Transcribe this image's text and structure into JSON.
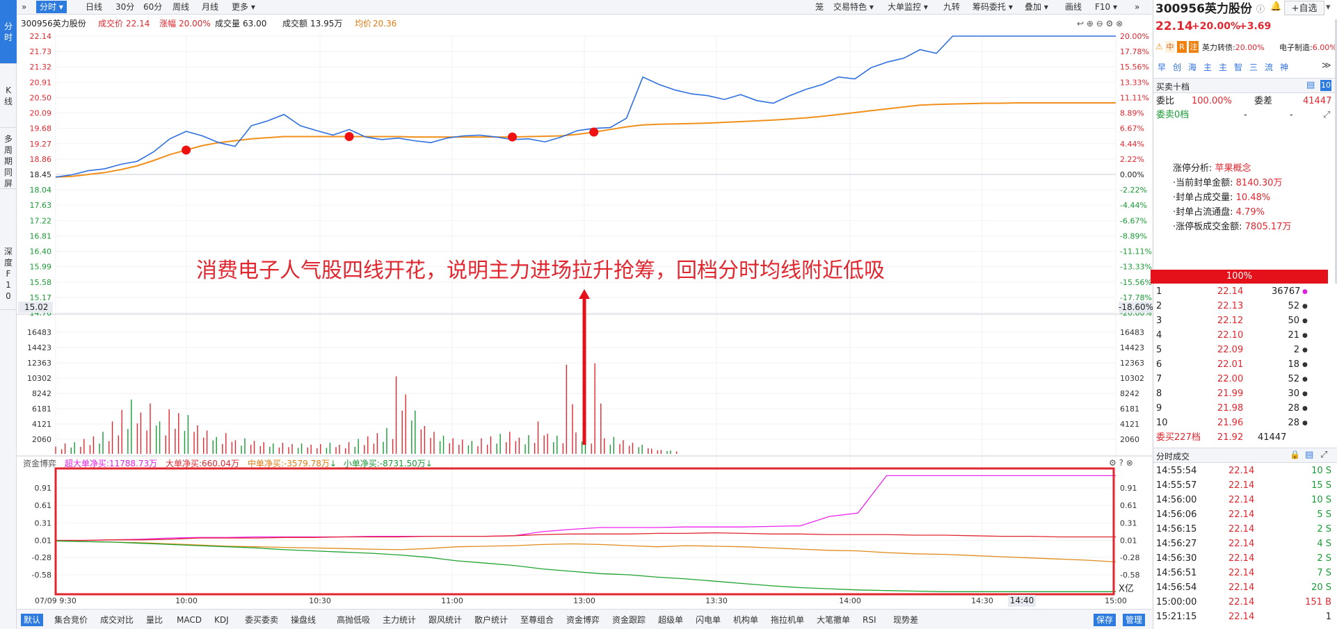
{
  "left_tabs": [
    {
      "label": "分时"
    },
    {
      "label": "K线"
    },
    {
      "label": "多周期同屏"
    },
    {
      "label": "深度F10"
    }
  ],
  "toolbar": {
    "expand_icon": "double-chevron-right-icon",
    "tabs": [
      "分时",
      "日线",
      "30分",
      "60分",
      "周线",
      "月线",
      "更多"
    ],
    "right_items": [
      "笼",
      "交易特色",
      "大单监控",
      "九转",
      "筹码委托",
      "叠加",
      "画线",
      "F10"
    ]
  },
  "stock": {
    "code_name": "300956英力股份",
    "price_label": "成交价",
    "price": "22.14",
    "change_label": "涨幅",
    "change": "20.00%",
    "volume_label": "成交量",
    "volume": "63.00",
    "amount_label": "成交额",
    "amount": "13.95万",
    "avg_label": "均价",
    "avg": "20.36"
  },
  "price_axis": {
    "left": [
      "22.14",
      "21.73",
      "21.32",
      "20.91",
      "20.50",
      "20.09",
      "19.68",
      "19.27",
      "18.86",
      "18.45",
      "18.04",
      "17.63",
      "17.22",
      "16.81",
      "16.40",
      "15.99",
      "15.58",
      "15.17",
      "14.76"
    ],
    "right": [
      "20.00%",
      "17.78%",
      "15.56%",
      "13.33%",
      "11.11%",
      "8.89%",
      "6.67%",
      "4.44%",
      "2.22%",
      "0.00%",
      "-2.22%",
      "-4.44%",
      "-6.67%",
      "-8.89%",
      "-11.11%",
      "-13.33%",
      "-15.56%",
      "-17.78%",
      "-20.00%"
    ],
    "cursor_left": "15.02",
    "cursor_right": "-18.60%"
  },
  "volume_axis": [
    "16483",
    "14423",
    "12363",
    "10302",
    "8242",
    "6181",
    "4121",
    "2060"
  ],
  "fund_panel": {
    "title": "资金博弈",
    "super_large": "超大单净买:11788.73万",
    "large": "大单净买:660.04万",
    "medium": "中单净买:-3579.78万",
    "small": "小单净买:-8731.50万",
    "axis": [
      "0.91",
      "0.61",
      "0.31",
      "0.01",
      "-0.28",
      "-0.58"
    ],
    "unit": "X亿"
  },
  "time_axis": [
    "07/09 9:30",
    "10:00",
    "10:30",
    "11:00",
    "13:00",
    "13:30",
    "14:00",
    "14:30",
    "15:00"
  ],
  "time_cursor": "14:40",
  "annotation": "消费电子人气股四线开花，说明主力进场拉升抢筹，回档分时均线附近低吸",
  "bottom_tabs": [
    "默认",
    "集合竞价",
    "成交对比",
    "量比",
    "MACD",
    "KDJ",
    "委买委卖",
    "操盘线",
    "高抛低吸",
    "主力统计",
    "跟风统计",
    "散户统计",
    "至尊组合",
    "资金博弈",
    "资金跟踪",
    "超级单",
    "闪电单",
    "机构单",
    "拖拉机单",
    "大笔撤单",
    "RSI",
    "现势差"
  ],
  "bottom_right": [
    "保存",
    "管理"
  ],
  "right_panel": {
    "title": "300956英力股份",
    "add_fav": "+自选",
    "price": "22.14",
    "change": "+20.00%",
    "change_abs": "+3.69",
    "badges": [
      "中",
      "R",
      "注"
    ],
    "bond": "英力转债:",
    "bond_change": "20.00%",
    "sector": "电子制造:",
    "sector_change": "6.00%",
    "quick_tabs": [
      "早",
      "创",
      "海",
      "主",
      "主",
      "智",
      "三",
      "流",
      "神"
    ],
    "order_book_title": "买卖十档",
    "wb_label": "委比",
    "wb": "100.00%",
    "wc_label": "委差",
    "wc": "41447",
    "sell_label": "委卖0档",
    "sell_dash": "-",
    "sell_dash2": "-",
    "limit_title": "涨停分析:",
    "limit_concept": "苹果概念",
    "limit_rows": [
      {
        "label": "·当前封单金额:",
        "value": "8140.30万"
      },
      {
        "label": "·封单占成交量:",
        "value": "10.48%"
      },
      {
        "label": "·封单占流通盘:",
        "value": "4.79%"
      },
      {
        "label": "·涨停板成交金额:",
        "value": "7805.17万"
      }
    ],
    "bar_pct": "100%",
    "bids": [
      {
        "n": "1",
        "p": "22.14",
        "v": "36767"
      },
      {
        "n": "2",
        "p": "22.13",
        "v": "52"
      },
      {
        "n": "3",
        "p": "22.12",
        "v": "50"
      },
      {
        "n": "4",
        "p": "22.10",
        "v": "21"
      },
      {
        "n": "5",
        "p": "22.09",
        "v": "2"
      },
      {
        "n": "6",
        "p": "22.01",
        "v": "18"
      },
      {
        "n": "7",
        "p": "22.00",
        "v": "52"
      },
      {
        "n": "8",
        "p": "21.99",
        "v": "30"
      },
      {
        "n": "9",
        "p": "21.98",
        "v": "28"
      },
      {
        "n": "10",
        "p": "21.96",
        "v": "28"
      }
    ],
    "buy_total_label": "委买227档",
    "buy_total_price": "21.92",
    "buy_total_vol": "41447",
    "ticks_title": "分时成交",
    "ticks": [
      {
        "t": "14:55:54",
        "p": "22.14",
        "v": "10 S"
      },
      {
        "t": "14:55:57",
        "p": "22.14",
        "v": "15 S"
      },
      {
        "t": "14:56:00",
        "p": "22.14",
        "v": "10 S"
      },
      {
        "t": "14:56:06",
        "p": "22.14",
        "v": "5 S"
      },
      {
        "t": "14:56:15",
        "p": "22.14",
        "v": "2 S"
      },
      {
        "t": "14:56:27",
        "p": "22.14",
        "v": "4 S"
      },
      {
        "t": "14:56:30",
        "p": "22.14",
        "v": "2 S"
      },
      {
        "t": "14:56:51",
        "p": "22.14",
        "v": "7 S"
      },
      {
        "t": "14:56:54",
        "p": "22.14",
        "v": "20 S"
      },
      {
        "t": "15:00:00",
        "p": "22.14",
        "v": "151 B"
      },
      {
        "t": "15:21:15",
        "p": "22.14",
        "v": "1"
      }
    ]
  },
  "chart_data": {
    "type": "line",
    "title": "",
    "series": [
      {
        "name": "price",
        "values": [
          18.38,
          18.44,
          18.55,
          18.6,
          18.72,
          18.8,
          19.05,
          19.4,
          19.6,
          19.48,
          19.3,
          19.2,
          19.75,
          19.88,
          20.05,
          19.75,
          19.62,
          19.5,
          19.65,
          19.45,
          19.38,
          19.42,
          19.35,
          19.3,
          19.42,
          19.48,
          19.5,
          19.45,
          19.38,
          19.4,
          19.32,
          19.45,
          19.62,
          19.68,
          19.7,
          19.95,
          21.05,
          20.85,
          20.7,
          20.6,
          20.55,
          20.45,
          20.58,
          20.42,
          20.35,
          20.55,
          20.72,
          20.85,
          21.05,
          21.0,
          21.3,
          21.45,
          21.55,
          21.78,
          21.68,
          22.14,
          22.14,
          22.14,
          22.14,
          22.14,
          22.14,
          22.14,
          22.14,
          22.14,
          22.14,
          22.14
        ]
      },
      {
        "name": "avg",
        "values": [
          18.38,
          18.4,
          18.45,
          18.5,
          18.58,
          18.68,
          18.82,
          18.98,
          19.1,
          19.22,
          19.3,
          19.35,
          19.4,
          19.43,
          19.46,
          19.46,
          19.46,
          19.46,
          19.46,
          19.46,
          19.46,
          19.46,
          19.45,
          19.45,
          19.45,
          19.45,
          19.45,
          19.45,
          19.45,
          19.46,
          19.47,
          19.48,
          19.52,
          19.58,
          19.65,
          19.72,
          19.77,
          19.79,
          19.8,
          19.81,
          19.82,
          19.84,
          19.86,
          19.88,
          19.9,
          19.93,
          19.96,
          20.0,
          20.05,
          20.1,
          20.15,
          20.2,
          20.25,
          20.3,
          20.32,
          20.33,
          20.34,
          20.35,
          20.35,
          20.36,
          20.36,
          20.36,
          20.36,
          20.36,
          20.36,
          20.36
        ]
      }
    ],
    "prev_close": 18.45,
    "ylim": [
      14.76,
      22.14
    ],
    "markers": [
      {
        "i": 8
      },
      {
        "i": 18
      },
      {
        "i": 28
      },
      {
        "i": 33
      }
    ],
    "volume": [
      900,
      1400,
      1600,
      2100,
      2500,
      3200,
      4800,
      6600,
      8200,
      6200,
      7600,
      4800,
      6700,
      6100,
      5800,
      4200,
      3400,
      2400,
      3000,
      1900,
      2200,
      1800,
      1600,
      1400,
      1500,
      1300,
      1400,
      1200,
      1300,
      1500,
      1200,
      1600,
      2100,
      2500,
      3000,
      3800,
      11800,
      9000,
      6500,
      4100,
      3200,
      2600,
      2200,
      2000,
      1800,
      2200,
      2500,
      2900,
      3200,
      2300,
      2700,
      4800,
      2900,
      2600,
      13600,
      3100,
      2500,
      13800,
      2200,
      2400,
      1900,
      1500,
      1200,
      600,
      400,
      300
    ],
    "fund_series": [
      {
        "name": "超大单净买",
        "values": [
          0.01,
          0.01,
          0.02,
          0.03,
          0.05,
          0.06,
          0.06,
          0.07,
          0.07,
          0.07,
          0.07,
          0.08,
          0.08,
          0.08,
          0.08,
          0.08,
          0.09,
          0.16,
          0.2,
          0.23,
          0.23,
          0.23,
          0.24,
          0.24,
          0.24,
          0.25,
          0.26,
          0.42,
          0.48,
          1.12,
          1.12,
          1.12,
          1.12,
          1.12,
          1.12,
          1.12,
          1.12,
          1.12
        ]
      },
      {
        "name": "大单净买",
        "values": [
          0.01,
          0.01,
          0.02,
          0.02,
          0.03,
          0.05,
          0.05,
          0.05,
          0.06,
          0.06,
          0.07,
          0.07,
          0.07,
          0.08,
          0.08,
          0.08,
          0.09,
          0.11,
          0.12,
          0.12,
          0.12,
          0.13,
          0.13,
          0.14,
          0.13,
          0.12,
          0.12,
          0.11,
          0.11,
          0.11,
          0.1,
          0.1,
          0.09,
          0.08,
          0.08,
          0.07,
          0.07,
          0.07
        ]
      },
      {
        "name": "中单净买",
        "values": [
          0.0,
          -0.01,
          -0.02,
          -0.03,
          -0.05,
          -0.07,
          -0.09,
          -0.1,
          -0.11,
          -0.12,
          -0.13,
          -0.14,
          -0.15,
          -0.13,
          -0.1,
          -0.09,
          -0.08,
          -0.06,
          -0.05,
          -0.06,
          -0.08,
          -0.1,
          -0.08,
          -0.09,
          -0.1,
          -0.12,
          -0.14,
          -0.16,
          -0.17,
          -0.2,
          -0.22,
          -0.23,
          -0.25,
          -0.27,
          -0.29,
          -0.31,
          -0.33,
          -0.36
        ]
      },
      {
        "name": "小单净买",
        "values": [
          0.0,
          -0.01,
          -0.02,
          -0.04,
          -0.06,
          -0.08,
          -0.1,
          -0.12,
          -0.15,
          -0.17,
          -0.19,
          -0.21,
          -0.24,
          -0.28,
          -0.34,
          -0.38,
          -0.42,
          -0.48,
          -0.52,
          -0.56,
          -0.58,
          -0.62,
          -0.65,
          -0.69,
          -0.73,
          -0.77,
          -0.8,
          -0.82,
          -0.84,
          -0.85,
          -0.86,
          -0.87,
          -0.87,
          -0.87,
          -0.87,
          -0.87,
          -0.87,
          -0.87
        ]
      }
    ],
    "colors": {
      "price": "#2e6fe0",
      "avg": "#f0901a",
      "super": "#ee22ee",
      "large": "#e0272f",
      "medium": "#e08a1a",
      "small": "#1ea22f",
      "up": "#e0272f",
      "down": "#199a35",
      "marker": "#ee1111",
      "highlight": "#e0272f"
    }
  }
}
